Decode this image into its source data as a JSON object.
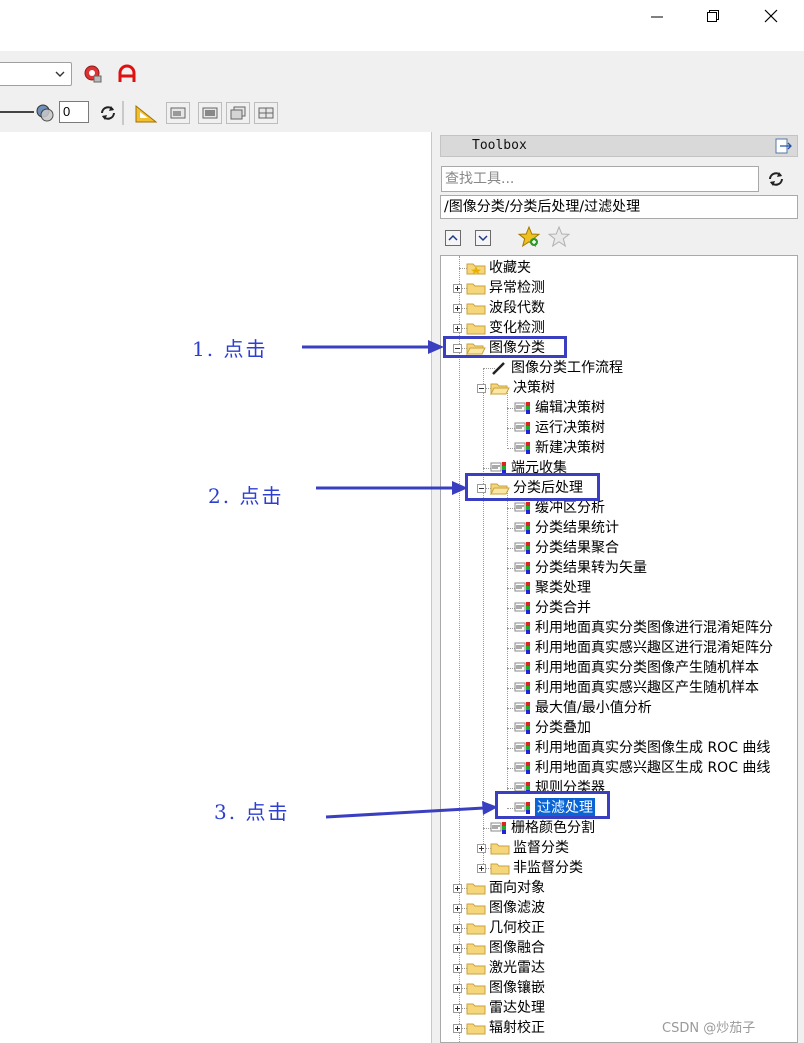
{
  "window": {
    "controls": [
      "minimize-icon",
      "restore-icon",
      "close-icon"
    ]
  },
  "toolbar": {
    "dropdown_value": "",
    "number_field": "0",
    "icons": [
      "gear-red-icon",
      "red-a-icon",
      "transparency-icon",
      "refresh-icon",
      "measure-icon",
      "view1-icon",
      "view2-icon",
      "view3-icon",
      "view4-icon"
    ]
  },
  "toolbox": {
    "title": "Toolbox",
    "search_placeholder": "查找工具...",
    "path": "/图像分类/分类后处理/过滤处理"
  },
  "tree": [
    {
      "label": "收藏夹"
    },
    {
      "label": "异常检测"
    },
    {
      "label": "波段代数"
    },
    {
      "label": "变化检测"
    },
    {
      "label": "图像分类"
    },
    {
      "label": "图像分类工作流程"
    },
    {
      "label": "决策树"
    },
    {
      "label": "编辑决策树"
    },
    {
      "label": "运行决策树"
    },
    {
      "label": "新建决策树"
    },
    {
      "label": "端元收集"
    },
    {
      "label": "分类后处理"
    },
    {
      "label": "缓冲区分析"
    },
    {
      "label": "分类结果统计"
    },
    {
      "label": "分类结果聚合"
    },
    {
      "label": "分类结果转为矢量"
    },
    {
      "label": "聚类处理"
    },
    {
      "label": "分类合并"
    },
    {
      "label": "利用地面真实分类图像进行混淆矩阵分"
    },
    {
      "label": "利用地面真实感兴趣区进行混淆矩阵分"
    },
    {
      "label": "利用地面真实分类图像产生随机样本"
    },
    {
      "label": "利用地面真实感兴趣区产生随机样本"
    },
    {
      "label": "最大值/最小值分析"
    },
    {
      "label": "分类叠加"
    },
    {
      "label": "利用地面真实分类图像生成 ROC 曲线"
    },
    {
      "label": "利用地面真实感兴趣区生成 ROC 曲线"
    },
    {
      "label": "规则分类器"
    },
    {
      "label": "过滤处理"
    },
    {
      "label": "栅格颜色分割"
    },
    {
      "label": "监督分类"
    },
    {
      "label": "非监督分类"
    },
    {
      "label": "面向对象"
    },
    {
      "label": "图像滤波"
    },
    {
      "label": "几何校正"
    },
    {
      "label": "图像融合"
    },
    {
      "label": "激光雷达"
    },
    {
      "label": "图像镶嵌"
    },
    {
      "label": "雷达处理"
    },
    {
      "label": "辐射校正"
    }
  ],
  "annotations": [
    "1. 点击",
    "2. 点击",
    "3. 点击"
  ],
  "annotation_color": "#3a3fc2",
  "selection_color": "#0a64d4",
  "watermark": "CSDN @炒茄子"
}
